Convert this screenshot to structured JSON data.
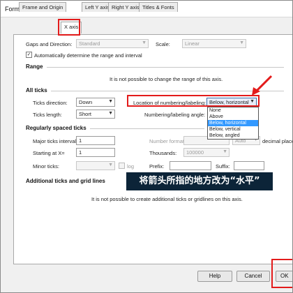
{
  "window": {
    "title": "Format Axes"
  },
  "tabs": [
    {
      "label": "Frame and Origin"
    },
    {
      "label": "X axis"
    },
    {
      "label": "Left Y axis"
    },
    {
      "label": "Right Y axis"
    },
    {
      "label": "Titles & Fonts"
    }
  ],
  "top": {
    "gaps_label": "Gaps and Direction:",
    "gaps_value": "Standard",
    "scale_label": "Scale:",
    "scale_value": "Linear",
    "auto_label": "Automatically determine the range and interval",
    "auto_checked": "✓"
  },
  "range": {
    "title": "Range",
    "message": "It is not possible to change the range of this axis."
  },
  "all_ticks": {
    "title": "All ticks",
    "direction_label": "Ticks direction:",
    "direction_value": "Down",
    "length_label": "Ticks length:",
    "length_value": "Short",
    "location_label": "Location of numbering/labeling:",
    "location_value": "Below, horizontal",
    "angle_label": "Numbering/labeling angle:",
    "location_options": [
      "None",
      "Above",
      "Below, horizontal",
      "Below, vertical",
      "Below, angled"
    ]
  },
  "regular": {
    "title": "Regularly spaced ticks",
    "major_label": "Major ticks interval:",
    "major_value": "1",
    "start_label": "Starting at X=",
    "start_value": "1",
    "minor_label": "Minor ticks:",
    "log_label": "log",
    "number_format_label": "Number format:",
    "auto_label": "Auto",
    "decimal_label": "decimal places",
    "thousands_label": "Thousands:",
    "thousands_value": "100000",
    "prefix_label": "Prefix:",
    "suffix_label": "Suffix:"
  },
  "additional": {
    "title": "Additional ticks and grid lines",
    "message": "It is not possible to create additional ticks or gridlines on this axis."
  },
  "annotation": {
    "text": "将箭头所指的地方改为“水平”"
  },
  "buttons": {
    "help": "Help",
    "cancel": "Cancel",
    "ok": "OK"
  },
  "colors": {
    "annotation_red": "#e31b1b",
    "selection_blue": "#3399ff",
    "banner_bg": "#0c2438"
  }
}
